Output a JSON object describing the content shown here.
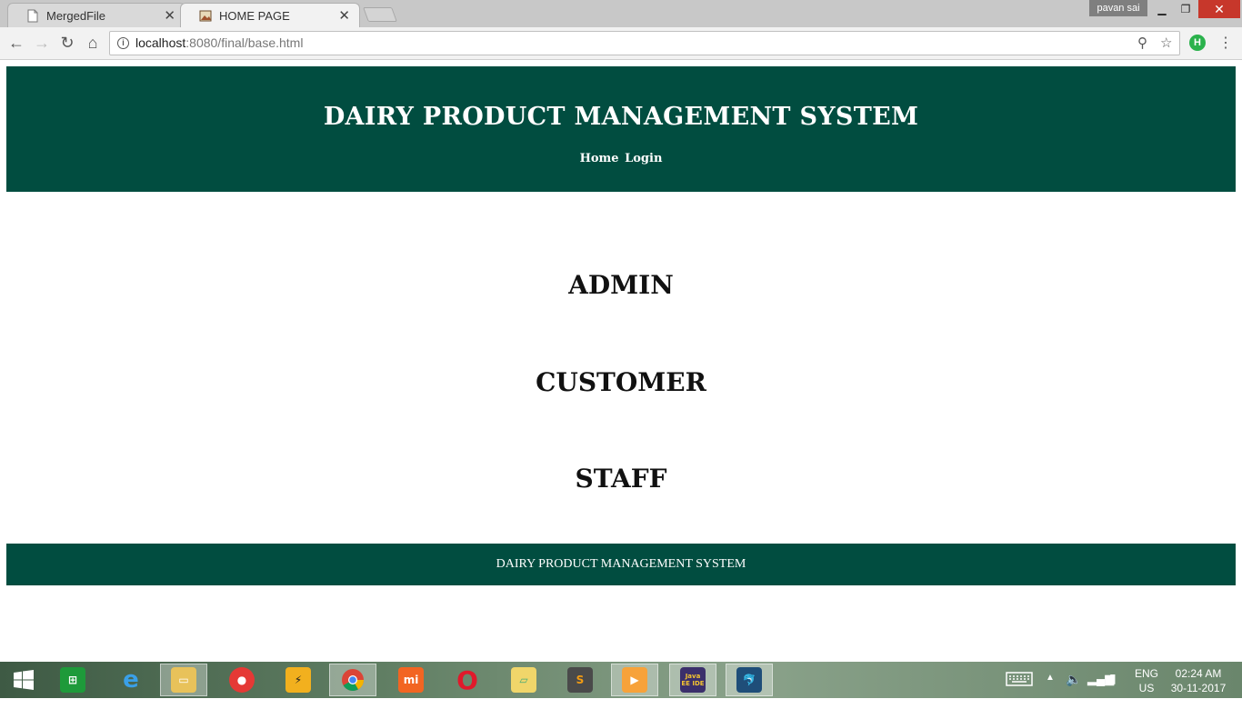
{
  "browser": {
    "tabs": [
      {
        "title": "MergedFile",
        "active": false
      },
      {
        "title": "HOME PAGE",
        "active": true
      }
    ],
    "user_badge": "pavan sai",
    "url_host": "localhost",
    "url_rest": ":8080/final/base.html",
    "extension_label": "H"
  },
  "site": {
    "title": "DAIRY PRODUCT MANAGEMENT SYSTEM",
    "nav": [
      "Home",
      "Login"
    ],
    "roles": [
      "ADMIN",
      "CUSTOMER",
      "STAFF"
    ],
    "footer": "DAIRY PRODUCT MANAGEMENT SYSTEM"
  },
  "taskbar": {
    "apps": [
      "start-icon",
      "store-icon",
      "internet-explorer-icon",
      "file-explorer-icon",
      "screen-recorder-icon",
      "winamp-icon",
      "chrome-icon",
      "mi-pc-suite-icon",
      "opera-icon",
      "photos-icon",
      "sublime-text-icon",
      "media-player-icon",
      "java-ee-ide-icon",
      "mysql-workbench-icon"
    ],
    "java_label": "Java EE IDE",
    "lang_top": "ENG",
    "lang_bottom": "US",
    "time": "02:24 AM",
    "date": "30-11-2017"
  },
  "colors": {
    "header_bg": "#014d40",
    "footer_bg": "#014d40",
    "close_btn": "#c7372b"
  }
}
